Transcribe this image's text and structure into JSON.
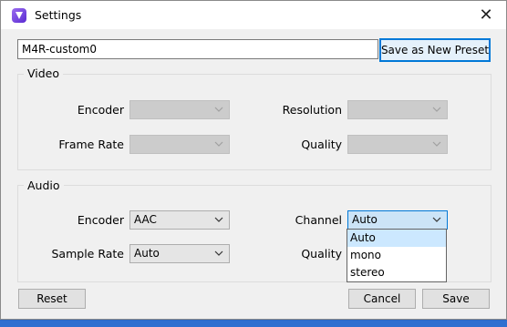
{
  "window": {
    "title": "Settings",
    "close_glyph": "✕"
  },
  "preset": {
    "name_value": "M4R-custom0",
    "save_new_label": "Save as New Preset"
  },
  "video": {
    "group_label": "Video",
    "encoder_label": "Encoder",
    "resolution_label": "Resolution",
    "frame_rate_label": "Frame Rate",
    "quality_label": "Quality"
  },
  "audio": {
    "group_label": "Audio",
    "encoder_label": "Encoder",
    "encoder_value": "AAC",
    "channel_label": "Channel",
    "channel_value": "Auto",
    "sample_rate_label": "Sample Rate",
    "sample_rate_value": "Auto",
    "quality_label": "Quality",
    "channel_options": [
      "Auto",
      "mono",
      "stereo"
    ]
  },
  "footer": {
    "reset_label": "Reset",
    "cancel_label": "Cancel",
    "save_label": "Save"
  },
  "colors": {
    "accent": "#0078d7",
    "desktop": "#2f6fd0",
    "dialog_bg": "#f0f0f0",
    "selected_item": "#cce8ff"
  },
  "icons": {
    "app": "app-logo-icon",
    "close": "close-icon",
    "dropdown": "chevron-down-icon"
  }
}
